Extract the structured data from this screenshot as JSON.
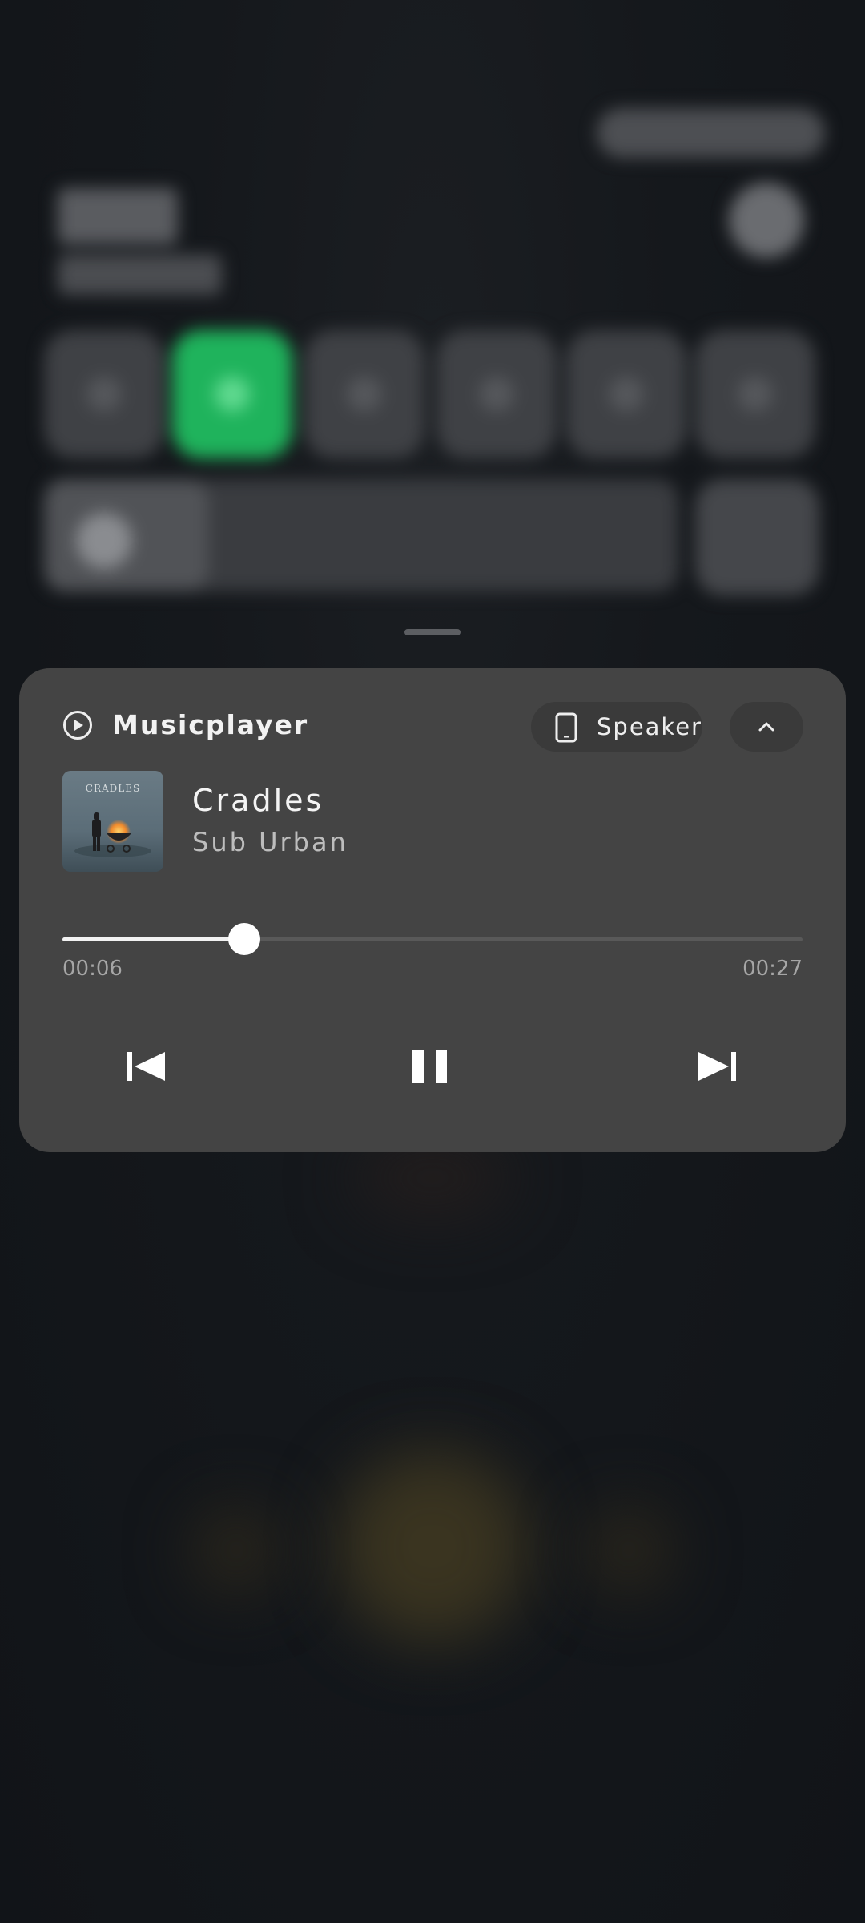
{
  "media": {
    "app_name": "Musicplayer",
    "output_device": "Speaker",
    "track_title": "Cradles",
    "artist": "Sub Urban",
    "elapsed": "00:06",
    "duration": "00:27",
    "progress_fraction": 0.246,
    "album_art_text": "CRADLES"
  },
  "icons": {
    "app": "play-circle-icon",
    "output": "phone-icon",
    "collapse": "chevron-up-icon",
    "previous": "skip-previous-icon",
    "play_state": "pause-icon",
    "next": "skip-next-icon"
  },
  "colors": {
    "card_background": "#444444",
    "accent_tile": "#1fb35c",
    "progress_fill": "#f2f2f2"
  }
}
